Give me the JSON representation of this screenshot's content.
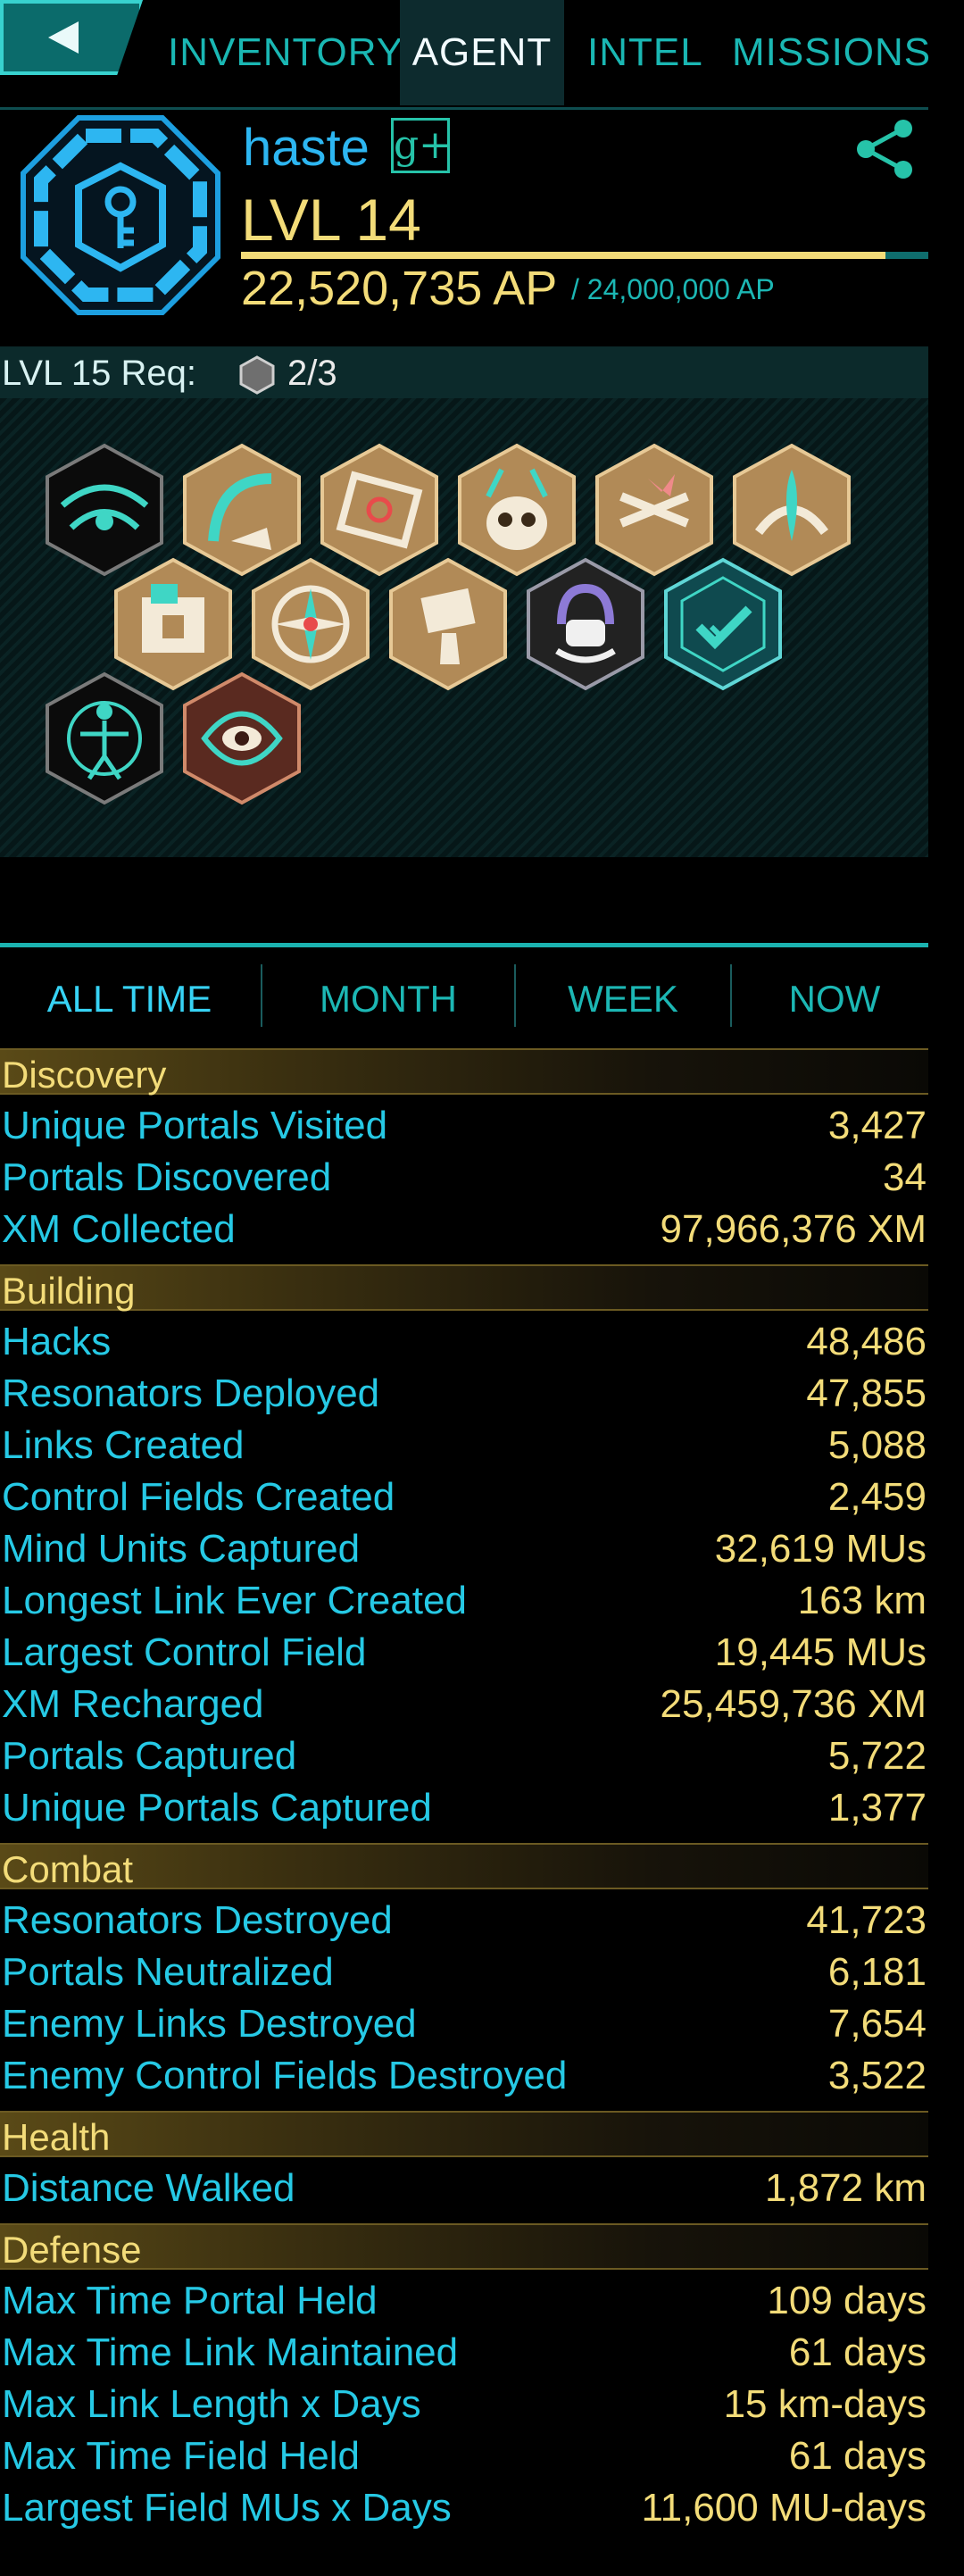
{
  "nav": {
    "tabs": [
      "INVENTORY",
      "AGENT",
      "INTEL",
      "MISSIONS"
    ],
    "active": "AGENT"
  },
  "agent": {
    "name": "haste",
    "gplus_label": "g+",
    "level": "LVL 14",
    "ap": "22,520,735 AP",
    "ap_max": "/ 24,000,000 AP",
    "level_progress": 0.9383,
    "faction_color": "#2db6f1"
  },
  "requirements": {
    "label": "LVL 15 Req:",
    "value": "2/3",
    "icon": "onyx-medal-icon"
  },
  "badges": [
    "sojourner-badge",
    "trekker-badge",
    "connector-badge",
    "purifier-badge",
    "guardian-badge",
    "mind-controller-badge",
    "builder-badge",
    "explorer-badge",
    "hacker-badge",
    "recharger-badge",
    "liberator-badge",
    "innovator-badge",
    "seer-badge"
  ],
  "time_tabs": [
    "ALL TIME",
    "MONTH",
    "WEEK",
    "NOW"
  ],
  "sections": [
    {
      "title": "Discovery",
      "rows": [
        [
          "Unique Portals Visited",
          "3,427"
        ],
        [
          "Portals Discovered",
          "34"
        ],
        [
          "XM Collected",
          "97,966,376 XM"
        ]
      ]
    },
    {
      "title": "Building",
      "rows": [
        [
          "Hacks",
          "48,486"
        ],
        [
          "Resonators Deployed",
          "47,855"
        ],
        [
          "Links Created",
          "5,088"
        ],
        [
          "Control Fields Created",
          "2,459"
        ],
        [
          "Mind Units Captured",
          "32,619 MUs"
        ],
        [
          "Longest Link Ever Created",
          "163 km"
        ],
        [
          "Largest Control Field",
          "19,445 MUs"
        ],
        [
          "XM Recharged",
          "25,459,736 XM"
        ],
        [
          "Portals Captured",
          "5,722"
        ],
        [
          "Unique Portals Captured",
          "1,377"
        ]
      ]
    },
    {
      "title": "Combat",
      "rows": [
        [
          "Resonators Destroyed",
          "41,723"
        ],
        [
          "Portals Neutralized",
          "6,181"
        ],
        [
          "Enemy Links Destroyed",
          "7,654"
        ],
        [
          "Enemy Control Fields Destroyed",
          "3,522"
        ]
      ]
    },
    {
      "title": "Health",
      "rows": [
        [
          "Distance Walked",
          "1,872 km"
        ]
      ]
    },
    {
      "title": "Defense",
      "rows": [
        [
          "Max Time Portal Held",
          "109 days"
        ],
        [
          "Max Time Link Maintained",
          "61 days"
        ],
        [
          "Max Link Length x Days",
          "15 km-days"
        ],
        [
          "Max Time Field Held",
          "61 days"
        ],
        [
          "Largest Field MUs x Days",
          "11,600 MU-days"
        ]
      ]
    }
  ]
}
